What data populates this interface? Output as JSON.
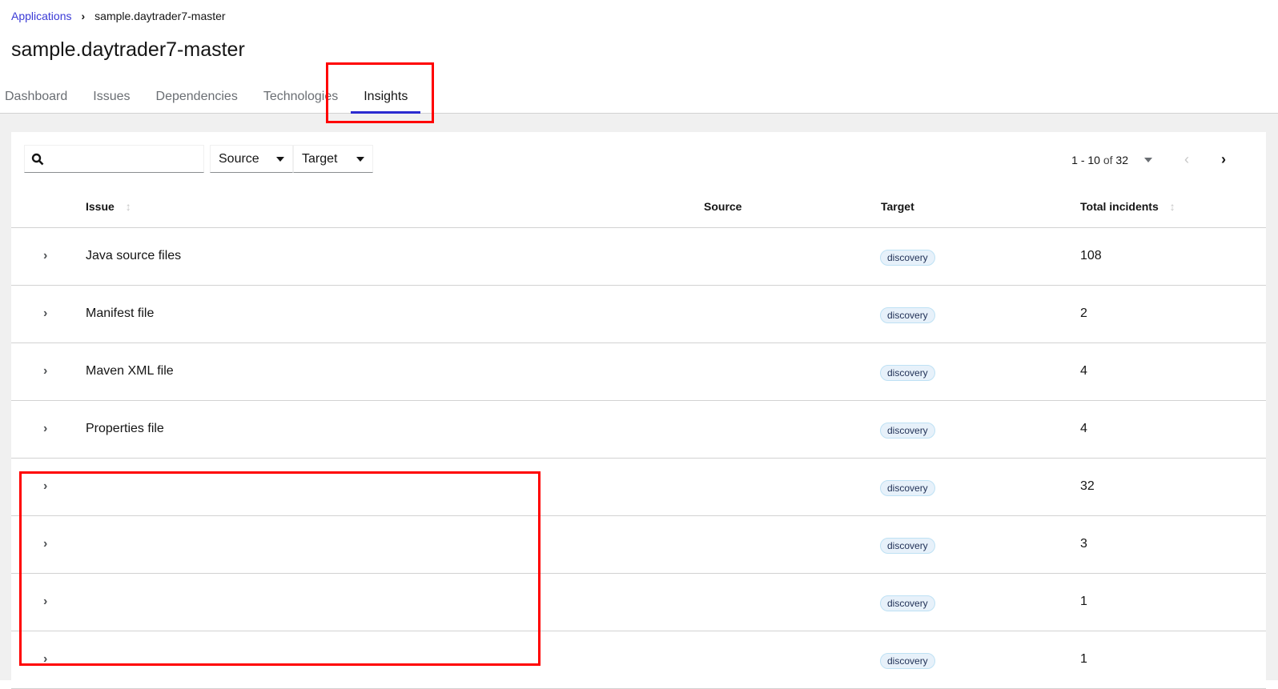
{
  "breadcrumb": {
    "link": "Applications",
    "current": "sample.daytrader7-master"
  },
  "title": "sample.daytrader7-master",
  "tabs": [
    "Dashboard",
    "Issues",
    "Dependencies",
    "Technologies",
    "Insights"
  ],
  "toolbar": {
    "search_placeholder": "",
    "source": "Source",
    "target": "Target"
  },
  "pagination": {
    "range": "1 - 10",
    "of": "of",
    "total": "32"
  },
  "columns": {
    "issue": "Issue",
    "source": "Source",
    "target": "Target",
    "incidents": "Total incidents"
  },
  "rows": [
    {
      "issue": "Java source files",
      "source": "",
      "target": "discovery",
      "incidents": "108"
    },
    {
      "issue": "Manifest file",
      "source": "",
      "target": "discovery",
      "incidents": "2"
    },
    {
      "issue": "Maven XML file",
      "source": "",
      "target": "discovery",
      "incidents": "4"
    },
    {
      "issue": "Properties file",
      "source": "",
      "target": "discovery",
      "incidents": "4"
    },
    {
      "issue": "",
      "source": "",
      "target": "discovery",
      "incidents": "32"
    },
    {
      "issue": "",
      "source": "",
      "target": "discovery",
      "incidents": "3"
    },
    {
      "issue": "",
      "source": "",
      "target": "discovery",
      "incidents": "1"
    },
    {
      "issue": "",
      "source": "",
      "target": "discovery",
      "incidents": "1"
    }
  ]
}
